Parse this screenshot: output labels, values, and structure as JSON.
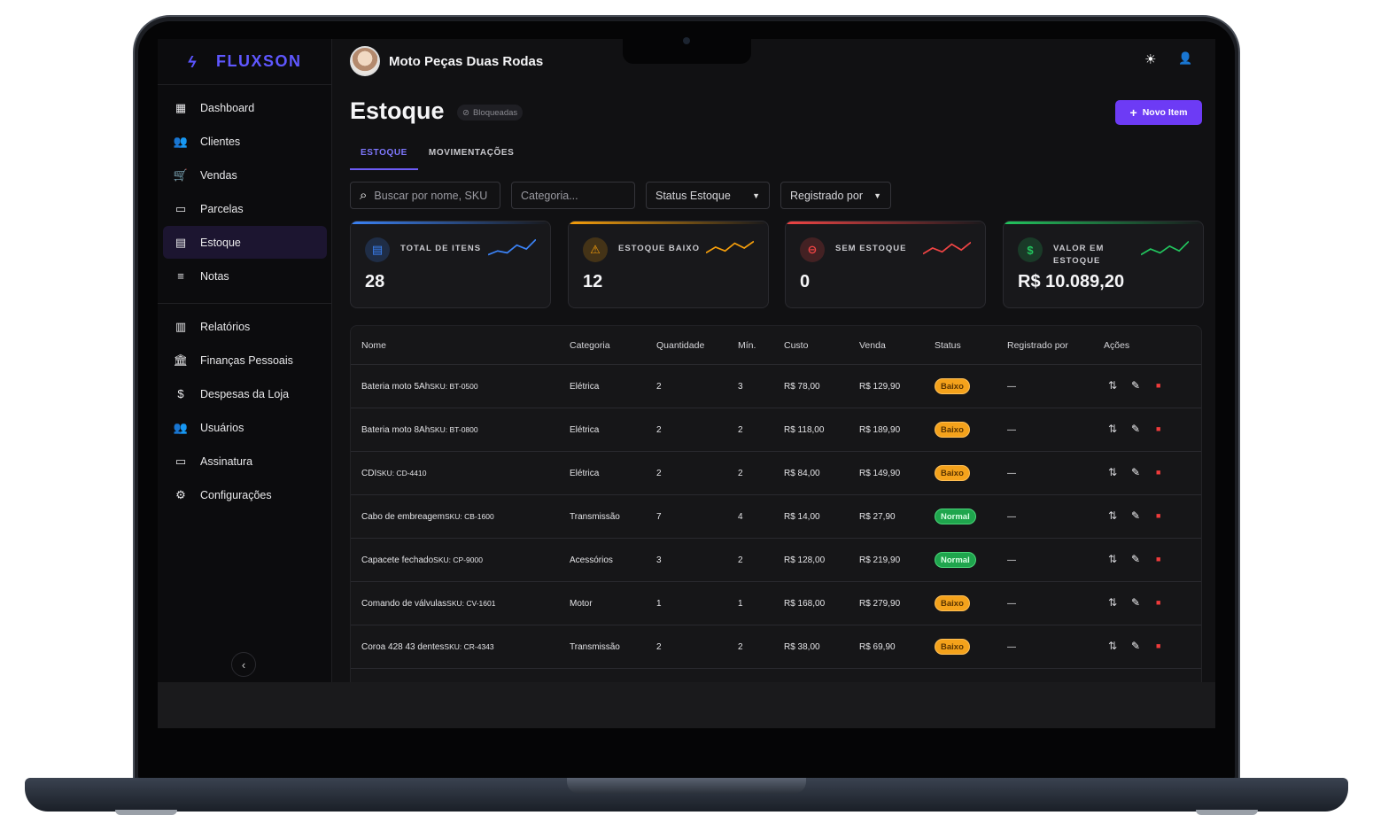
{
  "brand": {
    "name": "FLUXSON",
    "logo_icon": "ϟ",
    "accent": "#5f57ff"
  },
  "company": {
    "name": "Moto Peças Duas Rodas"
  },
  "sidebar": {
    "items": [
      {
        "label": "Dashboard",
        "icon": "▦",
        "active": false
      },
      {
        "label": "Clientes",
        "icon": "👥",
        "active": false
      },
      {
        "label": "Vendas",
        "icon": "🛒",
        "active": false
      },
      {
        "label": "Parcelas",
        "icon": "▭",
        "active": false
      },
      {
        "label": "Estoque",
        "icon": "▤",
        "active": true
      },
      {
        "label": "Notas",
        "icon": "≡",
        "active": false
      }
    ],
    "items2": [
      {
        "label": "Relatórios",
        "icon": "▥"
      },
      {
        "label": "Finanças Pessoais",
        "icon": "🏛"
      },
      {
        "label": "Despesas da Loja",
        "icon": "$"
      },
      {
        "label": "Usuários",
        "icon": "👥"
      },
      {
        "label": "Assinatura",
        "icon": "▭"
      },
      {
        "label": "Configurações",
        "icon": "⚙"
      }
    ],
    "collapse_icon": "‹"
  },
  "page": {
    "title": "Estoque",
    "chip": "Bloqueadas",
    "chip_icon": "⊘",
    "new_button": "Novo Item",
    "new_button_icon": "+",
    "tabs": [
      "ESTOQUE",
      "MOVIMENTAÇÕES"
    ]
  },
  "filters": {
    "search_placeholder": "Buscar por nome, SKU",
    "search_icon": "⌕",
    "category_placeholder": "Categoria...",
    "status": "Status Estoque",
    "registered": "Registrado por",
    "caret_icon": "▼"
  },
  "cards": [
    {
      "label": "TOTAL DE ITENS",
      "value": "28",
      "icon": "▤",
      "color": "#3b82f6",
      "bar": "#3b82f6"
    },
    {
      "label": "ESTOQUE BAIXO",
      "value": "12",
      "icon": "⚠",
      "color": "#f59e0b",
      "bar": "#f59e0b"
    },
    {
      "label": "SEM ESTOQUE",
      "value": "0",
      "icon": "⊖",
      "color": "#ef4444",
      "bar": "#ef4444"
    },
    {
      "label": "VALOR EM ESTOQUE",
      "value": "R$ 10.089,20",
      "icon": "$",
      "color": "#22c55e",
      "bar": "#22c55e"
    }
  ],
  "table": {
    "headers": [
      "Nome",
      "Categoria",
      "Quantidade",
      "Mín.",
      "Custo",
      "Venda",
      "Status",
      "Registrado por",
      "Ações"
    ],
    "rows": [
      {
        "name": "Bateria moto 5Ah",
        "sku": "SKU: BT-0500",
        "cat": "Elétrica",
        "qty": "2",
        "min": "3",
        "cost": "R$ 78,00",
        "sale": "R$ 129,90",
        "status": "Baixo",
        "reg": "—"
      },
      {
        "name": "Bateria moto 8Ah",
        "sku": "SKU: BT-0800",
        "cat": "Elétrica",
        "qty": "2",
        "min": "2",
        "cost": "R$ 118,00",
        "sale": "R$ 189,90",
        "status": "Baixo",
        "reg": "—"
      },
      {
        "name": "CDI",
        "sku": "SKU: CD-4410",
        "cat": "Elétrica",
        "qty": "2",
        "min": "2",
        "cost": "R$ 84,00",
        "sale": "R$ 149,90",
        "status": "Baixo",
        "reg": "—"
      },
      {
        "name": "Cabo de embreagem",
        "sku": "SKU: CB-1600",
        "cat": "Transmissão",
        "qty": "7",
        "min": "4",
        "cost": "R$ 14,00",
        "sale": "R$ 27,90",
        "status": "Normal",
        "reg": "—"
      },
      {
        "name": "Capacete fechado",
        "sku": "SKU: CP-9000",
        "cat": "Acessórios",
        "qty": "3",
        "min": "2",
        "cost": "R$ 128,00",
        "sale": "R$ 219,90",
        "status": "Normal",
        "reg": "—"
      },
      {
        "name": "Comando de válvulas",
        "sku": "SKU: CV-1601",
        "cat": "Motor",
        "qty": "1",
        "min": "1",
        "cost": "R$ 168,00",
        "sale": "R$ 279,90",
        "status": "Baixo",
        "reg": "—"
      },
      {
        "name": "Coroa 428 43 dentes",
        "sku": "SKU: CR-4343",
        "cat": "Transmissão",
        "qty": "2",
        "min": "2",
        "cost": "R$ 38,00",
        "sale": "R$ 69,90",
        "status": "Baixo",
        "reg": "—"
      }
    ],
    "action_icons": {
      "move": "⇅",
      "edit": "✎",
      "delete": "■"
    }
  },
  "top_icons": {
    "theme": "☀",
    "user": "👤"
  }
}
